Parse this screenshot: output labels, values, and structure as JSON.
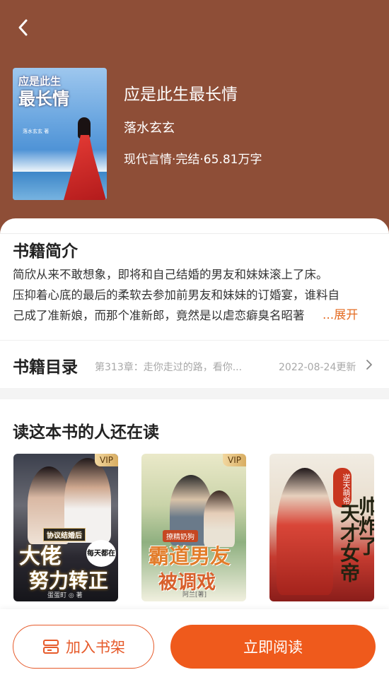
{
  "colors": {
    "header_bg": "#8e4e37",
    "accent": "#ef5a1c",
    "expand_link": "#e46c23"
  },
  "book": {
    "title": "应是此生最长情",
    "author": "落水玄玄",
    "meta": "现代言情·完结·65.81万字",
    "cover": {
      "line1": "应是此生",
      "line2": "最长情",
      "author_text": "落水玄玄 著"
    }
  },
  "intro": {
    "heading": "书籍简介",
    "line1": "简欣从来不敢想象，即将和自己结婚的男友和妹妹滚上了床。",
    "line2": "压抑着心底的最后的柔软去参加前男友和妹妹的订婚宴，谁料自",
    "line3": "己成了准新娘，而那个准新郎，竟然是以虐恋癖臭名昭著",
    "expand_label": "...展开"
  },
  "toc": {
    "heading": "书籍目录",
    "latest_chapter": "第313章：走你走过的路，看你...",
    "update_date": "2022-08-24更新",
    "chevron_icon": "chevron-right-icon"
  },
  "recommend": {
    "heading": "读这本书的人还在读",
    "books": [
      {
        "vip": "VIP",
        "tag": "协议结婚后",
        "title_top": "大佬",
        "title_bottom": "努力转正",
        "badge": "每天都在",
        "author_text": "蛋蛋町 ◎ 著"
      },
      {
        "vip": "VIP",
        "tag": "撩精奶狗",
        "title_top": "霸道男友",
        "title_bottom": "被调戏",
        "author_text": "阿兰[著]"
      },
      {
        "vip": "",
        "tag": "逆天萌帝",
        "title_top": "天才女帝",
        "title_bottom": "帅炸了"
      }
    ]
  },
  "actions": {
    "add_shelf_label": "加入书架",
    "add_shelf_icon": "bookshelf-icon",
    "read_label": "立即阅读"
  },
  "nav": {
    "back_icon": "back-arrow-icon"
  }
}
